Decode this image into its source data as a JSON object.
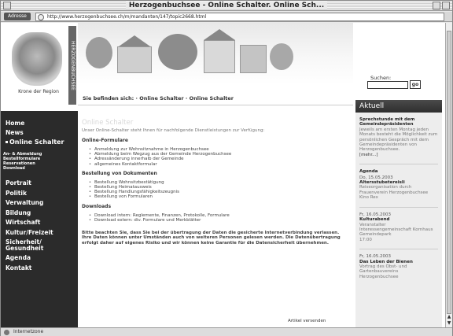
{
  "window": {
    "title": "Herzogenbuchsee - Online Schalter. Online Sch..."
  },
  "address": {
    "label": "Adresse",
    "url": "http://www.herzogenbuchsee.ch/m/mandanten/147/topic2668.html"
  },
  "status": {
    "text": "Internetzone"
  },
  "logo": {
    "caption": "Krone der Region",
    "vertical_text": "HERZOGENBUCHSEE"
  },
  "breadcrumb": "Sie befinden sich: · Online Schalter · Online Schalter",
  "search": {
    "label": "Suchen:",
    "button": "go"
  },
  "nav": {
    "primary": [
      "Home",
      "News",
      "Online Schalter"
    ],
    "sub": [
      "An- & Abmeldung",
      "Bestellformulare",
      "Reservationen",
      "Download"
    ],
    "secondary": [
      "Portrait",
      "Politik",
      "Verwaltung",
      "Bildung",
      "Wirtschaft",
      "Kultur/Freizeit",
      "Sicherheit/ Gesundheit",
      "Agenda",
      "Kontakt"
    ]
  },
  "main": {
    "title": "Online Schalter",
    "intro": "Unser Online-Schalter steht Ihnen für nachfolgende Dienstleistungen zur Verfügung:",
    "sections": [
      {
        "heading": "Online-Formulare",
        "items": [
          "Anmeldung zur Wohnsitznahme in Herzogenbuchsee",
          "Abmeldung beim Wegzug aus der Gemeinde Herzogenbuchsee",
          "Adressänderung innerhalb der Gemeinde",
          "allgemeines Kontaktformular"
        ]
      },
      {
        "heading": "Bestellung von Dokumenten",
        "items": [
          "Bestellung Wohnsitzbestätigung",
          "Bestellung Heimatausweis",
          "Bestellung Handlungsfähigkeitszeugnis",
          "Bestellung von Formularen"
        ]
      },
      {
        "heading": "Downloads",
        "items": [
          "Download intern: Reglemente, Finanzen, Protokolle, Formulare",
          "Download extern: div. Formulare und Merkblätter"
        ]
      }
    ],
    "notice": "Bitte beachten Sie, dass Sie bei der übertragung der Daten die gesicherte Internetverbindung verlassen. Ihre Daten können unter Umständen auch von weiteren Personen gelesen werden. Die Datenübertragung erfolgt daher auf eigenes Risiko und wir können keine Garantie für die Datensicherheit übernehmen.",
    "send_article": "Artikel versenden"
  },
  "aside": {
    "title": "Aktuell",
    "news": {
      "heading": "Sprechstunde mit dem Gemeindepräsidenten",
      "text": "Jeweils am ersten Montag jeden Monats besteht die Möglichkeit zum persönlichen Gespräch mit dem Gemeindepräsidenten von Herzogenbuchsee.",
      "more": "[mehr...]"
    },
    "agenda_title": "Agenda",
    "events": [
      {
        "date": "Do, 15.05.2003",
        "title": "Altersstubetereisli",
        "lines": [
          "Reiseorganisation durch Frauenverein Herzogenbuchsee",
          "Kino Rex"
        ]
      },
      {
        "date": "Fr, 16.05.2003",
        "title": "Kulturabend",
        "lines": [
          "Veranstalter Interessengemeinschaft Kornhaus",
          "Gemeindepark",
          "17:00"
        ]
      },
      {
        "date": "Fr, 16.05.2003",
        "title": "Das Leben der Bienen",
        "lines": [
          "Vortrag des Obst- und Gartenbauvereins Herzogenbuchsee"
        ]
      }
    ]
  }
}
